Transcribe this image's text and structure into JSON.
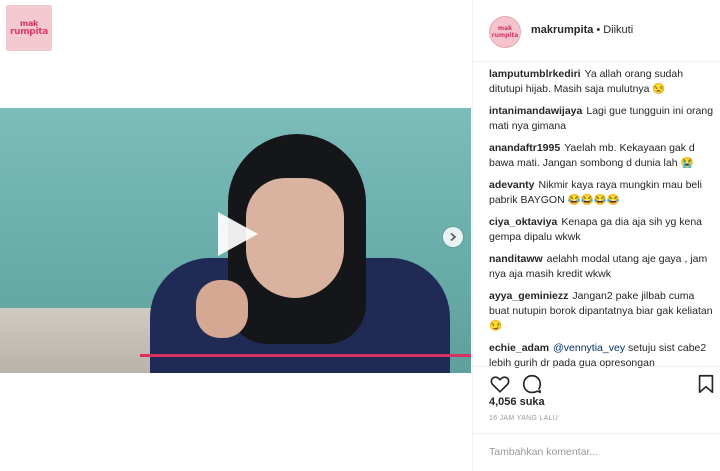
{
  "page_logo": {
    "line1": "mak",
    "line2": "rumpita"
  },
  "header": {
    "username": "makrumpita",
    "separator": "•",
    "follow_status": "Diikuti"
  },
  "media": {
    "play_icon": "play-icon",
    "next_icon": "chevron-right-icon",
    "progress_color": "#d8305f"
  },
  "comments": [
    {
      "user": "lamputumblrkediri",
      "text": "Ya allah orang sudah ditutupi hijab. Masih saja mulutnya 😒"
    },
    {
      "user": "intanimandawijaya",
      "text": "Lagi gue tungguin ini orang mati nya gimana"
    },
    {
      "user": "anandaftr1995",
      "text": "Yaelah mb. Kekayaan gak d bawa mati. Jangan sombong d dunia lah 😭"
    },
    {
      "user": "adevanty",
      "text": "Nikmir kaya raya mungkin mau beli pabrik BAYGON 😂😂😂😂"
    },
    {
      "user": "ciya_oktaviya",
      "text": "Kenapa ga dia aja sih yg kena gempa dipalu wkwk"
    },
    {
      "user": "nanditaww",
      "text": "aelahh modal utang aje gaya , jam nya aja masih kredit wkwk"
    },
    {
      "user": "ayya_geminiezz",
      "text": "Jangan2 pake jilbab cuma buat nutupin borok dipantatnya biar gak keliatan😏"
    },
    {
      "user": "echie_adam",
      "mention": "@vennytia_vey",
      "text": "setuju sist cabe2 lebih gurih dr pada gua opresongan"
    }
  ],
  "actions": {
    "like_icon": "heart-icon",
    "comment_icon": "comment-icon",
    "save_icon": "bookmark-icon"
  },
  "likes": "4,056 suka",
  "time": "16 JAM YANG LALU",
  "add_comment": {
    "placeholder": "Tambahkan komentar..."
  }
}
